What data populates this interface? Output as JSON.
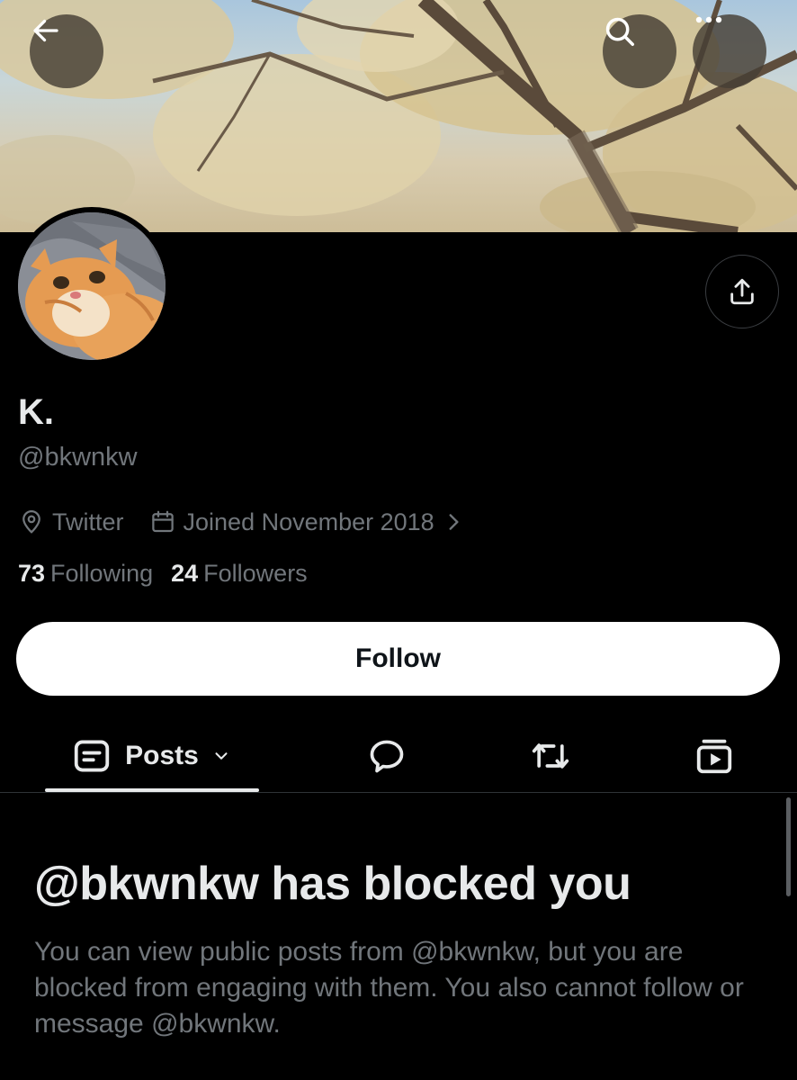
{
  "header": {
    "back_icon": "arrow-left-icon",
    "search_icon": "search-icon",
    "more_icon": "more-horizontal-icon"
  },
  "profile": {
    "display_name": "K.",
    "handle": "@bkwnkw",
    "location": "Twitter",
    "joined": "Joined November 2018",
    "following_count": "73",
    "following_label": "Following",
    "followers_count": "24",
    "followers_label": "Followers"
  },
  "actions": {
    "follow_label": "Follow",
    "share_icon": "share-icon"
  },
  "tabs": {
    "posts_label": "Posts",
    "items": [
      "posts-icon",
      "replies-icon",
      "reposts-icon",
      "media-icon"
    ]
  },
  "blocked": {
    "title": "@bkwnkw has blocked you",
    "description": "You can view public posts from @bkwnkw, but you are blocked from engaging with them. You also cannot follow or message @bkwnkw."
  },
  "colors": {
    "background": "#000000",
    "primary_text": "#e7e9ea",
    "secondary_text": "#71767b",
    "button_bg": "#ffffff",
    "button_text": "#0f1419"
  }
}
